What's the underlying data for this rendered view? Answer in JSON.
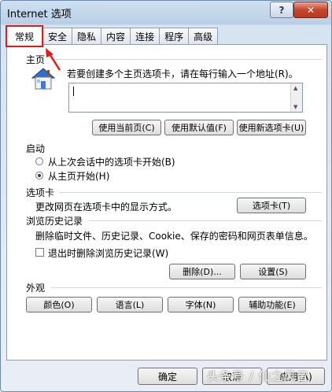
{
  "window": {
    "title": "Internet 选项",
    "help_label": "?",
    "close_label": "✕"
  },
  "tabs": [
    "常规",
    "安全",
    "隐私",
    "内容",
    "连接",
    "程序",
    "高级"
  ],
  "home": {
    "heading": "主页",
    "desc": "若要创建多个主页选项卡，请在每行输入一个地址(R)。",
    "value": "",
    "buttons": [
      "使用当前页(C)",
      "使用默认值(F)",
      "使用新选项卡(U)"
    ]
  },
  "startup": {
    "heading": "启动",
    "options": [
      "从上次会话中的选项卡开始(B)",
      "从主页开始(H)"
    ],
    "selected_index": 1
  },
  "tabsec": {
    "heading": "选项卡",
    "desc": "更改网页在选项卡中的显示方式。",
    "button": "选项卡(T)"
  },
  "history": {
    "heading": "浏览历史记录",
    "desc": "删除临时文件、历史记录、Cookie、保存的密码和网页表单信息。",
    "checkbox": "退出时删除浏览历史记录(W)",
    "checked": false,
    "delete_btn": "删除(D)...",
    "settings_btn": "设置(S)"
  },
  "appearance": {
    "heading": "外观",
    "buttons": [
      "颜色(O)",
      "语言(L)",
      "字体(N)",
      "辅助功能(E)"
    ]
  },
  "footer": {
    "ok": "确定",
    "cancel": "取消",
    "apply": "应用(A)"
  },
  "watermark": "头条号 / 仙之风音",
  "colors": {
    "highlight": "#e81818"
  }
}
